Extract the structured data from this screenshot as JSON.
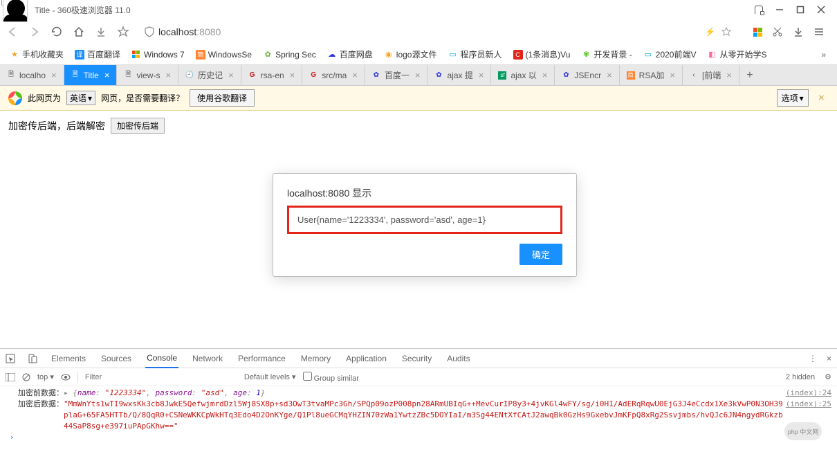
{
  "window": {
    "avatar_badge": "社",
    "title": "Title - 360极速浏览器 11.0"
  },
  "address": {
    "host": "localhost",
    "port": ":8080"
  },
  "bookmarks": [
    {
      "icon": "star",
      "label": "手机收藏夹"
    },
    {
      "icon": "blue",
      "glyph": "译",
      "label": "百度翻译"
    },
    {
      "icon": "win",
      "label": "Windows 7"
    },
    {
      "icon": "orange",
      "glyph": "简",
      "label": "WindowsSe"
    },
    {
      "icon": "spring",
      "label": "Spring Sec"
    },
    {
      "icon": "baidu",
      "label": "百度网盘"
    },
    {
      "icon": "logo",
      "label": "logo源文件"
    },
    {
      "icon": "bili",
      "label": "程序员新人"
    },
    {
      "icon": "red",
      "glyph": "C",
      "label": "(1条消息)Vu"
    },
    {
      "icon": "leaf",
      "label": "开发背景 -"
    },
    {
      "icon": "bili",
      "label": "2020前端V"
    },
    {
      "icon": "pink",
      "label": "从零开始学S"
    }
  ],
  "tabs": [
    {
      "icon": "page",
      "label": "localho",
      "active": false
    },
    {
      "icon": "page",
      "label": "Title",
      "active": true
    },
    {
      "icon": "page",
      "label": "view-s",
      "active": false
    },
    {
      "icon": "hist",
      "label": "历史记",
      "active": false
    },
    {
      "icon": "g",
      "label": "rsa-en",
      "active": false
    },
    {
      "icon": "g",
      "label": "src/ma",
      "active": false
    },
    {
      "icon": "baidu",
      "label": "百度一",
      "active": false
    },
    {
      "icon": "baidu",
      "label": "ajax 提",
      "active": false
    },
    {
      "icon": "sf",
      "label": "ajax 以",
      "active": false
    },
    {
      "icon": "baidu",
      "label": "JSEncr",
      "active": false
    },
    {
      "icon": "orange",
      "glyph": "简",
      "label": "RSA加",
      "active": false
    },
    {
      "icon": "chev",
      "label": "[前端",
      "active": false
    }
  ],
  "translate": {
    "pre": "此网页为",
    "lang": "英语",
    "post": "网页，是否需要翻译？",
    "button": "使用谷歌翻译",
    "options": "选项"
  },
  "page": {
    "heading": "加密传后端，后端解密",
    "button": "加密传后端"
  },
  "dialog": {
    "title": "localhost:8080 显示",
    "body": "User{name='1223334', password='asd', age=1}",
    "ok": "确定"
  },
  "devtools": {
    "tabs": [
      "Elements",
      "Sources",
      "Console",
      "Network",
      "Performance",
      "Memory",
      "Application",
      "Security",
      "Audits"
    ],
    "active_tab": "Console",
    "context": "top",
    "filter_placeholder": "Filter",
    "levels": "Default levels",
    "group": "Group similar",
    "hidden": "2 hidden",
    "rows": {
      "r1_label": "加密前数据：",
      "r1_obj_open": "{",
      "r1_k1": "name",
      "r1_v1": "\"1223334\"",
      "r1_k2": "password",
      "r1_v2": "\"asd\"",
      "r1_k3": "age",
      "r1_v3": "1",
      "r1_obj_close": "}",
      "r1_src": "(index):24",
      "r2_label": "加密后数据：",
      "r2_val": "\"MmWnYts1wTI9wxsKk3cb8JwkE5QefwjmrdDzl5Wj8SX8p+sd3OwT3tvaMPc3Gh/SPQp09ozP008pn28ARmUBIqG++MevCurIP8y3+4jvKGl4wFY/sg/i0H1/AdERqRqwU0EjG3J4eCcdx1Xe3kVwP0N3OH39plaG+65FA5HTTb/Q/8QqR0+CSNeWKKCpWkHTq3Edo4D2OnKYge/Q1Pl8ueGCMqYHZIN70zWa1YwtzZBc5DOYIaI/m3Sg44ENtXfCAtJ2awqBk0GzHs9GxebvJmKFpQ8xRg2Ssvjmbs/hvQJc6JN4ngydRGkzb44SaP8sg+e397iuPApGKhw==\"",
      "r2_src": "(index):25"
    }
  },
  "watermark": "php 中文网"
}
